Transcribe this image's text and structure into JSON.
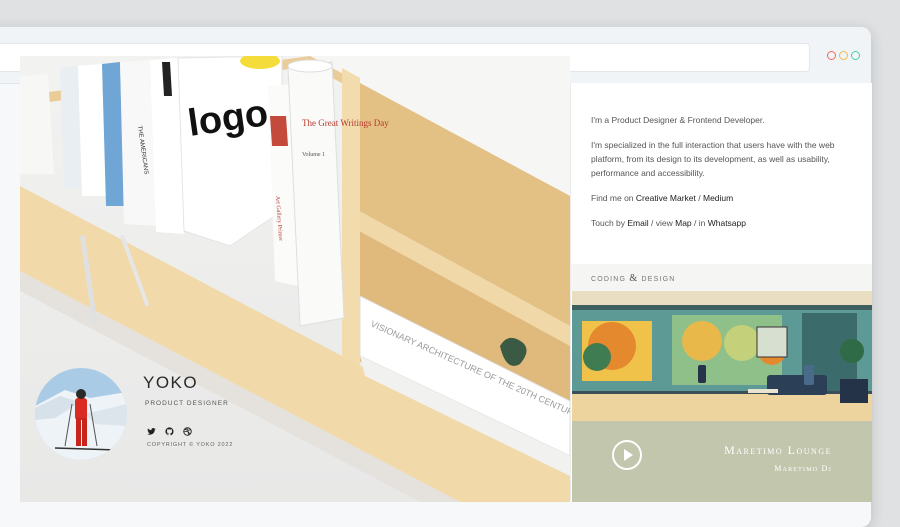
{
  "window": {
    "dots": [
      "#f2685a",
      "#f3b74a",
      "#4fcf9e"
    ]
  },
  "bio": {
    "intro": "I'm a Product Designer & Frontend Developer.",
    "specialized": "I'm specialized in the full interaction that users have with the web platform, from its design to its development, as well as usability, performance and accessibility.",
    "find_prefix": "Find me on ",
    "find_links": [
      "Creative Market",
      "Medium"
    ],
    "separator": " / ",
    "touch_prefix": "Touch by ",
    "touch_email": "Email",
    "touch_view": " / view ",
    "touch_map": "Map",
    "touch_in": " / in ",
    "touch_whatsapp": "Whatsapp"
  },
  "section": {
    "before": "coding ",
    "amp": "&",
    "after": " design"
  },
  "player": {
    "track": "Maretimo Lounge",
    "artist": "Maretimo Dj"
  },
  "profile": {
    "name": "YOKO",
    "role": "PRODUCT DESIGNER",
    "copyright": "COPYRIGHT © YOKO 2022",
    "socials": [
      "twitter-icon",
      "github-icon",
      "dribbble-icon"
    ]
  },
  "hero": {
    "book_logo": "logo",
    "book_title": "The Great Writings Day",
    "book_volume": "Volume 1",
    "book_spine": "Art Gallery Primer",
    "book_americans": "THE AMERICANS",
    "book_visionary": "VISIONARY ARCHITECTURE OF THE 20TH CENTURY"
  }
}
